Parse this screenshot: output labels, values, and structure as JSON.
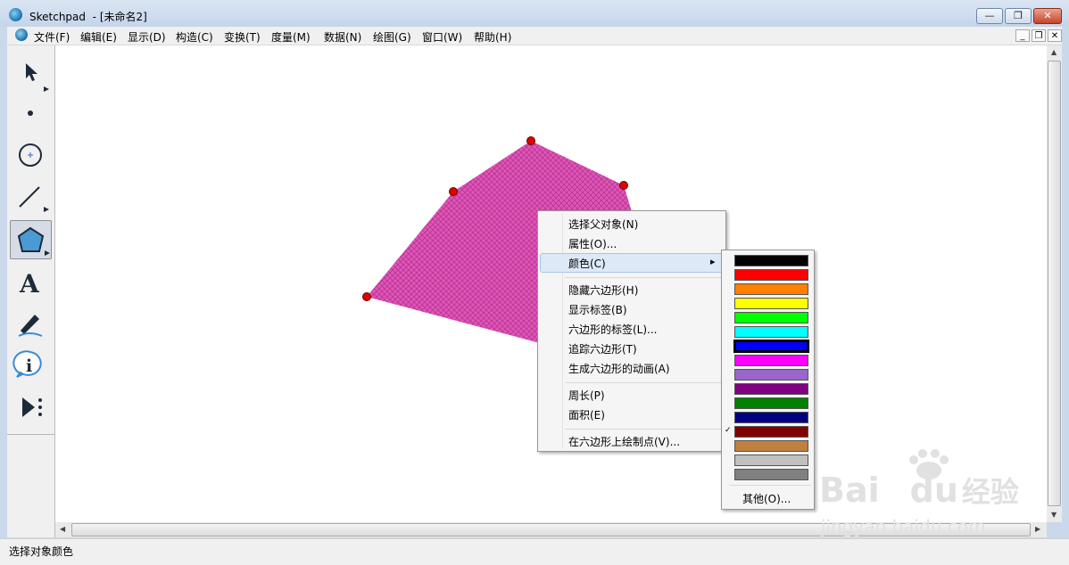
{
  "window": {
    "app_name": "Sketchpad",
    "title": "- [未命名2]",
    "status": "选择对象颜色"
  },
  "menu": [
    "文件(F)",
    "编辑(E)",
    "显示(D)",
    "构造(C)",
    "变换(T)",
    "度量(M)",
    "数据(N)",
    "绘图(G)",
    "窗口(W)",
    "帮助(H)"
  ],
  "tools": [
    "arrow-select-icon",
    "point-tool-icon",
    "compass-tool-icon",
    "straightedge-tool-icon",
    "polygon-tool-icon",
    "text-tool-icon",
    "marker-tool-icon",
    "information-tool-icon",
    "custom-tool-icon"
  ],
  "tools_selected": "polygon-tool-icon",
  "text_tool_glyph": "A",
  "info_tool_glyph": "i",
  "polygon": {
    "fill": "#e055b8",
    "vertex_color": "#e00000"
  },
  "context_menu": {
    "items": [
      "选择父对象(N)",
      "属性(O)...",
      "颜色(C)",
      "隐藏六边形(H)",
      "显示标签(B)",
      "六边形的标签(L)...",
      "追踪六边形(T)",
      "生成六边形的动画(A)",
      "周长(P)",
      "面积(E)",
      "在六边形上绘制点(V)..."
    ],
    "highlighted": "颜色(C)",
    "submenu_arrow": "▸"
  },
  "color_submenu": {
    "colors": [
      "#000000",
      "#ff0000",
      "#ff8000",
      "#ffff00",
      "#00ff00",
      "#00ffff",
      "#0000ff",
      "#ff00ff",
      "#9966cc",
      "#800080",
      "#008000",
      "#000080",
      "#800000",
      "#c08040",
      "#c0c0c0",
      "#808080"
    ],
    "selected_index": 6,
    "check_index": 12,
    "check_glyph": "✓",
    "other_label": "其他(O)..."
  },
  "watermark": {
    "brand": "Bai",
    "brand_tail": "du",
    "brand_cn": "经验",
    "url": "jingyan.baidu.com"
  }
}
